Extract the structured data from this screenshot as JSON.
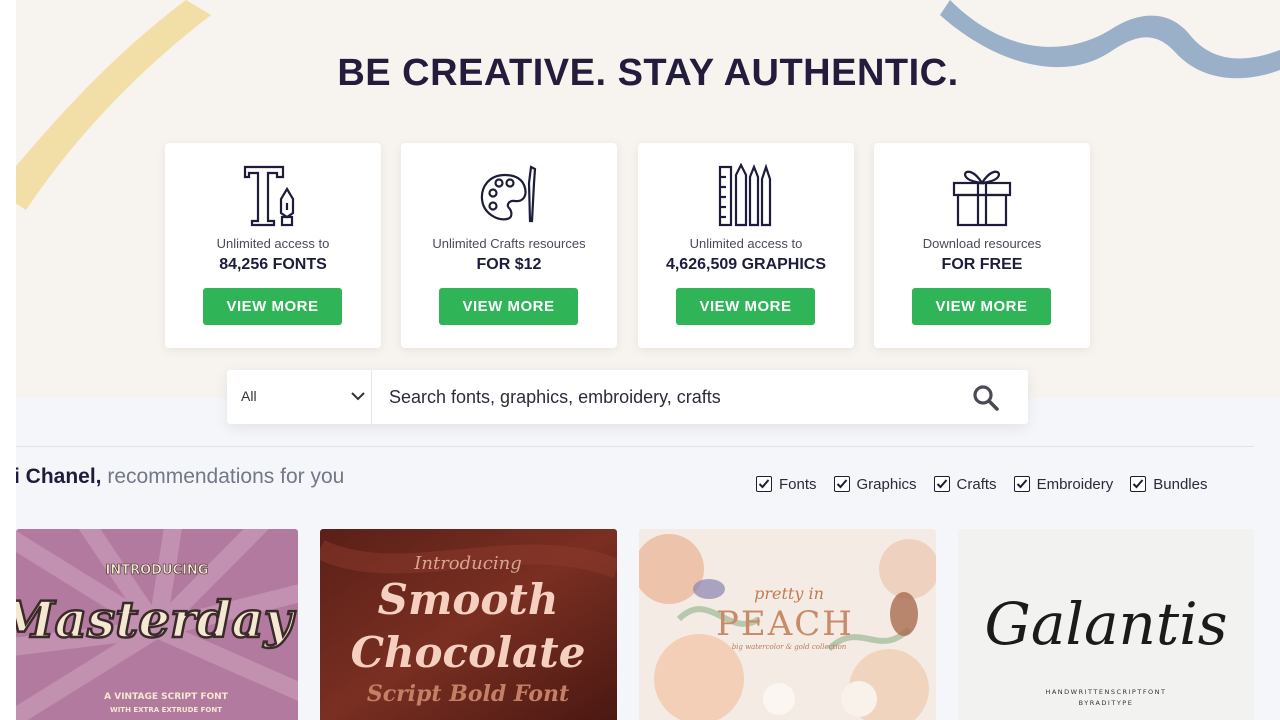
{
  "hero": {
    "title": "BE CREATIVE. STAY AUTHENTIC.",
    "cards": [
      {
        "icon": "font-pen-icon",
        "line1": "Unlimited access to",
        "line2": "84,256 FONTS",
        "button": "VIEW MORE"
      },
      {
        "icon": "palette-icon",
        "line1": "Unlimited Crafts resources",
        "line2": "FOR $12",
        "button": "VIEW MORE"
      },
      {
        "icon": "pencils-icon",
        "line1": "Unlimited access to",
        "line2": "4,626,509 GRAPHICS",
        "button": "VIEW MORE"
      },
      {
        "icon": "gift-icon",
        "line1": "Download resources",
        "line2": "FOR FREE",
        "button": "VIEW MORE"
      }
    ]
  },
  "search": {
    "category": "All",
    "placeholder": "Search fonts, graphics, embroidery, crafts",
    "icon": "search-icon"
  },
  "recommendations": {
    "name": "i Chanel,",
    "rest": " recommendations for you",
    "filters": [
      {
        "label": "Fonts",
        "checked": true
      },
      {
        "label": "Graphics",
        "checked": true
      },
      {
        "label": "Crafts",
        "checked": true
      },
      {
        "label": "Embroidery",
        "checked": true
      },
      {
        "label": "Bundles",
        "checked": true
      }
    ],
    "products": [
      {
        "line1": "INTRODUCING",
        "title": "Masterday",
        "line2": "A VINTAGE SCRIPT FONT",
        "line3": "WITH EXTRA EXTRUDE FONT"
      },
      {
        "line1": "Introducing",
        "title": "Smooth",
        "title2": "Chocolate",
        "line2": "Script Bold Font"
      },
      {
        "line1": "pretty in",
        "title": "PEACH",
        "line2": "big watercolor & gold collection"
      },
      {
        "title": "Galantis",
        "line1": "HANDWRITTENSCRIPTFONT",
        "line2": "BYRADITYPE"
      }
    ]
  },
  "colors": {
    "accent_green": "#2fb457",
    "hero_bg": "#f7f3ee",
    "title": "#241c3d"
  }
}
